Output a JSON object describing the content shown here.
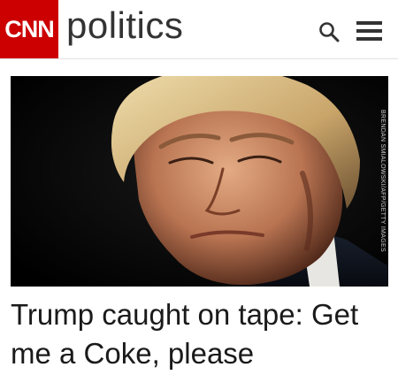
{
  "header": {
    "logo_text": "CNN",
    "section_title": "politics",
    "search_icon": "search-icon",
    "menu_icon": "hamburger-menu-icon"
  },
  "colors": {
    "brand_red": "#cc0000",
    "title_text": "#333333",
    "headline_text": "#1a1a1a"
  },
  "article": {
    "image_credit": "BRENDAN SMIALOWSKI/AFP/GETTY IMAGES",
    "headline": "Trump caught on tape: Get me a Coke, please"
  }
}
